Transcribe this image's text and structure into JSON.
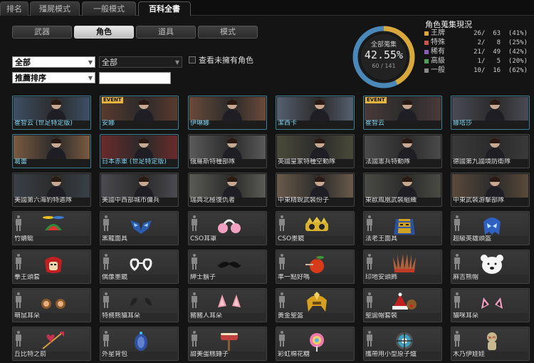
{
  "top_tabs": [
    "排名",
    "殭屍模式",
    "一般模式",
    "百科全書"
  ],
  "active_top_tab": 3,
  "sub_tabs": [
    "武器",
    "角色",
    "道具",
    "模式"
  ],
  "active_sub_tab": 1,
  "filters": {
    "category": "全部",
    "sub_category": "全部",
    "sort": "推薦排序",
    "search_value": "",
    "show_unowned_label": "查看未擁有角色",
    "show_unowned_checked": false
  },
  "collection": {
    "title": "全部蒐集",
    "percent": "42.55%",
    "fraction": "60 / 141",
    "progress": 0.4255
  },
  "stats": {
    "title": "角色蒐集現況",
    "rows": [
      {
        "name": "王牌",
        "value": "26/  63  (41%)",
        "color": "#d9a73a"
      },
      {
        "name": "特殊",
        "value": " 2/   8  (25%)",
        "color": "#c9544a"
      },
      {
        "name": "稀有",
        "value": "21/  49  (42%)",
        "color": "#8a5fb5"
      },
      {
        "name": "高級",
        "value": " 1/   5  (20%)",
        "color": "#4f9e5a"
      },
      {
        "name": "一般",
        "value": "10/  16  (62%)",
        "color": "#8a8a8a"
      }
    ]
  },
  "icons": {
    "dropdown_arrow": "chevron-down-icon",
    "locked_placeholder": "person-silhouette-icon"
  },
  "characters": [
    {
      "name": "崔智云 (世足特定版)",
      "owned": true,
      "event": false,
      "kind": "photo",
      "bg": "#3e4f66"
    },
    {
      "name": "安娜",
      "owned": true,
      "event": true,
      "kind": "photo",
      "bg": "#5a3a2e"
    },
    {
      "name": "伊琳娜",
      "owned": true,
      "event": false,
      "kind": "photo",
      "bg": "#6a4a3a"
    },
    {
      "name": "潔西卡",
      "owned": true,
      "event": false,
      "kind": "photo",
      "bg": "#556070"
    },
    {
      "name": "崔智云",
      "owned": true,
      "event": true,
      "kind": "photo",
      "bg": "#4a3a3a"
    },
    {
      "name": "娜塔莎",
      "owned": true,
      "event": false,
      "kind": "photo",
      "bg": "#4a4a55"
    },
    {
      "name": "葛蕾",
      "owned": true,
      "event": false,
      "kind": "photo",
      "bg": "#7a5a40"
    },
    {
      "name": "日本赤軍 (世足特定版)",
      "owned": true,
      "event": false,
      "kind": "photo",
      "bg": "#6a2a2a"
    },
    {
      "name": "俄羅斯特種部隊",
      "owned": false,
      "event": false,
      "kind": "photo",
      "bg": "#5a5a5a"
    },
    {
      "name": "英國皇家特種空勤隊",
      "owned": false,
      "event": false,
      "kind": "photo",
      "bg": "#4a4a3a"
    },
    {
      "name": "法國憲兵特勤隊",
      "owned": false,
      "event": false,
      "kind": "photo",
      "bg": "#4a4a4a"
    },
    {
      "name": "德國第九國境防衛隊",
      "owned": false,
      "event": false,
      "kind": "photo",
      "bg": "#3a3a3a"
    },
    {
      "name": "美國第六海豹特遣隊",
      "owned": false,
      "event": false,
      "kind": "photo",
      "bg": "#3a4048"
    },
    {
      "name": "美國中西部城市傭兵",
      "owned": false,
      "event": false,
      "kind": "photo",
      "bg": "#4a4a50"
    },
    {
      "name": "瑞典北極復仇者",
      "owned": false,
      "event": false,
      "kind": "photo",
      "bg": "#5a5a55"
    },
    {
      "name": "中東精銳武裝份子",
      "owned": false,
      "event": false,
      "kind": "photo",
      "bg": "#6a5a4a"
    },
    {
      "name": "東歐鳳凰武裝組織",
      "owned": false,
      "event": false,
      "kind": "photo",
      "bg": "#4a4a45"
    },
    {
      "name": "中東武裝游擊部隊",
      "owned": false,
      "event": false,
      "kind": "photo",
      "bg": "#5a4a3a"
    },
    {
      "name": "竹蜻蜓",
      "owned": false,
      "event": false,
      "kind": "propeller-hat-icon",
      "c": "#d33"
    },
    {
      "name": "黑龍面具",
      "owned": false,
      "event": false,
      "kind": "dragon-mask-icon",
      "c": "#2a5cb0"
    },
    {
      "name": "CSO耳罩",
      "owned": false,
      "event": false,
      "kind": "earmuffs-icon",
      "c": "#f0a0c0"
    },
    {
      "name": "CSO墨鏡",
      "owned": false,
      "event": false,
      "kind": "party-glasses-icon",
      "c": "#d8b030"
    },
    {
      "name": "法老王面具",
      "owned": false,
      "event": false,
      "kind": "pharaoh-mask-icon",
      "c": "#d0a020"
    },
    {
      "name": "超級英雄頭盔",
      "owned": false,
      "event": false,
      "kind": "hero-helmet-icon",
      "c": "#3060c0"
    },
    {
      "name": "拳王頭套",
      "owned": false,
      "event": false,
      "kind": "boxing-headgear-icon",
      "c": "#c02020"
    },
    {
      "name": "偶像墨鏡",
      "owned": false,
      "event": false,
      "kind": "heart-glasses-icon",
      "c": "#f2f2f2"
    },
    {
      "name": "紳士鬍子",
      "owned": false,
      "event": false,
      "kind": "mustache-icon",
      "c": "#111"
    },
    {
      "name": "準一點好嗎",
      "owned": false,
      "event": false,
      "kind": "apple-icon",
      "c": "#d83a1a"
    },
    {
      "name": "印地安頭飾",
      "owned": false,
      "event": false,
      "kind": "feather-headdress-icon",
      "c": "#b0603a"
    },
    {
      "name": "麻吉熊帽",
      "owned": false,
      "event": false,
      "kind": "bear-hat-icon",
      "c": "#f5f5f5"
    },
    {
      "name": "萌鼠耳朵",
      "owned": false,
      "event": false,
      "kind": "mouse-ears-icon",
      "c": "#8a5a2a"
    },
    {
      "name": "特務熊貓耳朵",
      "owned": false,
      "event": false,
      "kind": "panda-ears-icon",
      "c": "#222"
    },
    {
      "name": "豬豬人耳朵",
      "owned": false,
      "event": false,
      "kind": "pig-ears-icon",
      "c": "#f0a0b0"
    },
    {
      "name": "黃金聖盔",
      "owned": false,
      "event": false,
      "kind": "golden-helmet-icon",
      "c": "#d8a020"
    },
    {
      "name": "聖誕帽套裝",
      "owned": false,
      "event": false,
      "kind": "santa-hat-icon",
      "c": "#c02020"
    },
    {
      "name": "貓咪耳朵",
      "owned": false,
      "event": false,
      "kind": "cat-ears-icon",
      "c": "#f2a0c0"
    },
    {
      "name": "丘比特之箭",
      "owned": false,
      "event": false,
      "kind": "cupid-arrow-icon",
      "c": "#c83050"
    },
    {
      "name": "外星背包",
      "owned": false,
      "event": false,
      "kind": "alien-backpack-icon",
      "c": "#3050a0"
    },
    {
      "name": "甜美蛋糕錘子",
      "owned": false,
      "event": false,
      "kind": "cake-hammer-icon",
      "c": "#c04040"
    },
    {
      "name": "彩虹棉花糖",
      "owned": false,
      "event": false,
      "kind": "rainbow-candy-icon",
      "c": "#f07ab0"
    },
    {
      "name": "攜帶用小型原子爐",
      "owned": false,
      "event": false,
      "kind": "atom-reactor-icon",
      "c": "#40a0c0"
    },
    {
      "name": "木乃伊娃娃",
      "owned": false,
      "event": false,
      "kind": "mummy-doll-icon",
      "c": "#c8b890"
    }
  ]
}
